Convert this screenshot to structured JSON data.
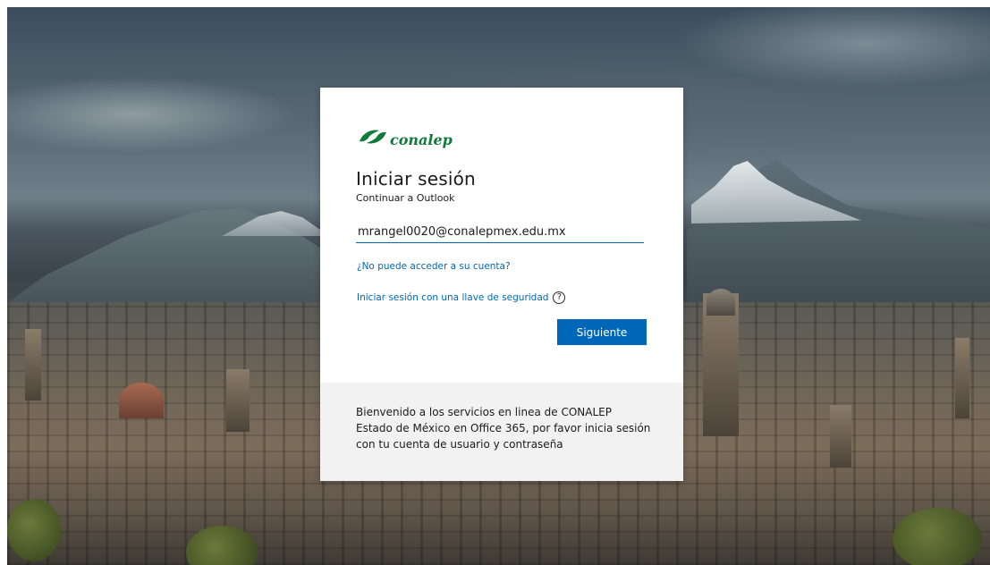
{
  "brand": {
    "name": "conalep",
    "color": "#0f7a3a"
  },
  "signin": {
    "title": "Iniciar sesión",
    "subtitle": "Continuar a Outlook",
    "email_value": "mrangel0020@conalepmex.edu.mx",
    "cant_access_link": "¿No puede acceder a su cuenta?",
    "security_key_link": "Iniciar sesión con una llave de seguridad",
    "help_icon": "question-circle-icon",
    "help_glyph": "?",
    "next_label": "Siguiente",
    "accent_color": "#0067b8"
  },
  "footer": {
    "welcome_message": "Bienvenido a los servicios en linea de CONALEP Estado de México en Office 365, por favor inicia sesión con tu cuenta de usuario y contraseña"
  }
}
